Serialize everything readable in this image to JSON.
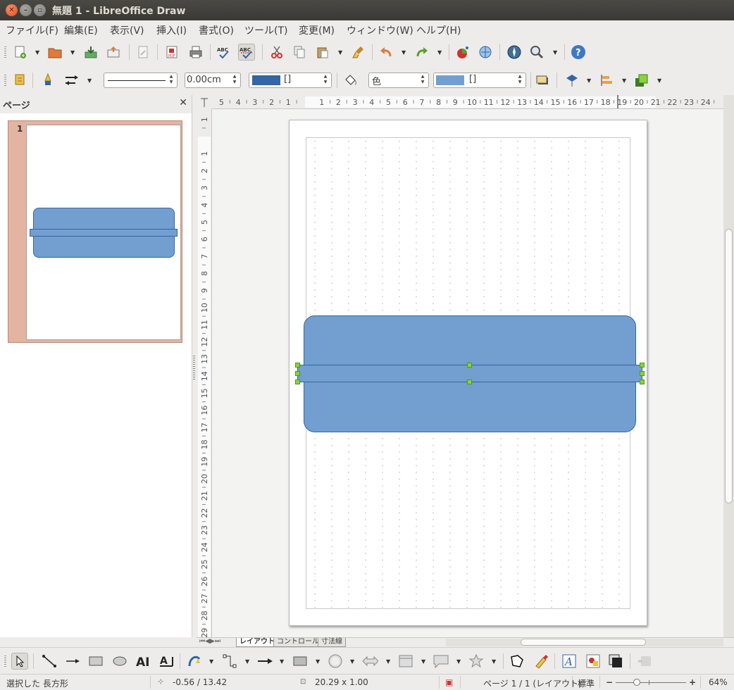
{
  "window": {
    "title": "無題 1 - LibreOffice Draw"
  },
  "menu": [
    "ファイル(F)",
    "編集(E)",
    "表示(V)",
    "挿入(I)",
    "書式(O)",
    "ツール(T)",
    "変更(M)",
    "ウィンドウ(W)",
    "ヘルプ(H)"
  ],
  "line_toolbar": {
    "line_width": "0.00cm",
    "line_color_label": "[]",
    "area_style": "色",
    "area_color_label": "[]"
  },
  "pages_panel": {
    "title": "ページ",
    "page_number": "1"
  },
  "ruler": {
    "h_labels": [
      "5",
      "4",
      "3",
      "2",
      "1",
      "1",
      "2",
      "3",
      "4",
      "5",
      "6",
      "7",
      "8",
      "9",
      "10",
      "11",
      "12",
      "13",
      "14",
      "15",
      "16",
      "17",
      "18",
      "19",
      "20",
      "21",
      "22",
      "23",
      "24"
    ],
    "v_labels": [
      "1",
      "1",
      "2",
      "3",
      "4",
      "5",
      "6",
      "7",
      "8",
      "9",
      "10",
      "11",
      "12",
      "13",
      "14",
      "15",
      "16",
      "17",
      "18",
      "19",
      "20",
      "21",
      "22",
      "23",
      "24",
      "25",
      "26",
      "27",
      "28",
      "29"
    ]
  },
  "tabs": [
    "レイアウト",
    "コントロール",
    "寸法線"
  ],
  "status": {
    "selection": "選択した 長方形",
    "position": "-0.56 / 13.42",
    "size": "20.29 x 1.00",
    "page": "ページ 1 / 1 (レイアウト)",
    "style": "標準",
    "zoom": "64%"
  },
  "colors": {
    "shape_fill": "#729fcf",
    "shape_border": "#3465a4",
    "handle": "#8bd337"
  }
}
